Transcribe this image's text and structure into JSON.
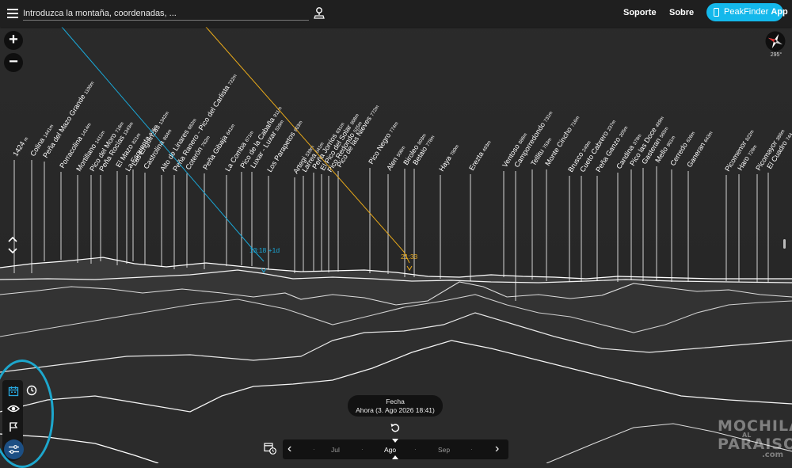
{
  "topbar": {
    "search_placeholder": "Introduzca la montaña, coordenadas, ...",
    "support_label": "Soporte",
    "about_label": "Sobre",
    "app_brand": "PeakFinder",
    "app_label": "App",
    "app_color": "#14b8eb"
  },
  "controls": {
    "zoom_in": "+",
    "zoom_out": "−",
    "heading": "295°",
    "scroll_up_icon": "chevron-up-icon",
    "scroll_down_icon": "chevron-down-icon"
  },
  "sidebar": {
    "icons": [
      "calendar-icon",
      "clock-icon",
      "eye-icon",
      "flag-icon",
      "sliders-icon"
    ],
    "active_color": "#1c4f84",
    "highlight_color": "#1da7cd"
  },
  "peaks": [
    {
      "name": "1424",
      "elevation": "m"
    },
    {
      "name": "Colina",
      "elevation": "1441m"
    },
    {
      "name": "Peña del Mazo Grande",
      "elevation": "1190m"
    },
    {
      "name": "Porracolina",
      "elevation": "1414m"
    },
    {
      "name": "Mortillano",
      "elevation": "1411m"
    },
    {
      "name": "Pico del Moro",
      "elevation": "716m"
    },
    {
      "name": "Peña Rocías",
      "elevation": "1343m"
    },
    {
      "name": "El Mazo",
      "elevation": "821m"
    },
    {
      "name": "La Esquenta",
      "elevation": "976m"
    },
    {
      "name": "Las Enguinzas",
      "elevation": "1342m"
    },
    {
      "name": "Castrolina",
      "elevation": "864m"
    },
    {
      "name": "Alto de Linares",
      "elevation": "682m"
    },
    {
      "name": "Peña Ranero - Pico del Carlista",
      "elevation": "722m"
    },
    {
      "name": "Coterón",
      "elevation": "762m"
    },
    {
      "name": "Peña Gibaja",
      "elevation": "641m"
    },
    {
      "name": "La Comba",
      "elevation": "671m"
    },
    {
      "name": "Pico de la Cabaña",
      "elevation": "911m"
    },
    {
      "name": "Luxar - Luxar",
      "elevation": "528m"
    },
    {
      "name": "Los Parapetos",
      "elevation": "803m"
    },
    {
      "name": "Artegi",
      "elevation": "539m"
    },
    {
      "name": "Larrea",
      "elevation": "541m"
    },
    {
      "name": "Peña Jorrios",
      "elevation": "631m"
    },
    {
      "name": "El Pico del Solar",
      "elevation": "808m"
    },
    {
      "name": "Pico Redondo",
      "elevation": "525m"
    },
    {
      "name": "Pico de las Nieves",
      "elevation": "772m"
    },
    {
      "name": "Pico Negro",
      "elevation": "774m"
    },
    {
      "name": "Alen",
      "elevation": "506m"
    },
    {
      "name": "Biroleo",
      "elevation": "803m"
    },
    {
      "name": "Betaio",
      "elevation": "778m"
    },
    {
      "name": "Haya",
      "elevation": "780m"
    },
    {
      "name": "Erezta",
      "elevation": "493m"
    },
    {
      "name": "Ventoso",
      "elevation": "886m"
    },
    {
      "name": "Camporredondo",
      "elevation": "731m"
    },
    {
      "name": "Tellitu",
      "elevation": "753m"
    },
    {
      "name": "Monte Cincho",
      "elevation": "716m"
    },
    {
      "name": "Brusco",
      "elevation": "249m"
    },
    {
      "name": "Cueto Cabrero",
      "elevation": "237m"
    },
    {
      "name": "Peña Ganzo",
      "elevation": "205m"
    },
    {
      "name": "Candina",
      "elevation": "378m"
    },
    {
      "name": "Pico las Doce",
      "elevation": "489m"
    },
    {
      "name": "Gasteran",
      "elevation": "565m"
    },
    {
      "name": "Mello",
      "elevation": "801m"
    },
    {
      "name": "Cerredo",
      "elevation": "626m"
    },
    {
      "name": "Ganeran",
      "elevation": "643m"
    },
    {
      "name": "Picomenor",
      "elevation": "822m"
    },
    {
      "name": "Haro",
      "elevation": "728m"
    },
    {
      "name": "Picomayor",
      "elevation": "386m"
    },
    {
      "name": "El Cuadro",
      "elevation": "744"
    }
  ],
  "sun": {
    "moon_label": "13:18 +1d",
    "sun_label": "21:33",
    "moon_color": "#1aa7d6",
    "sun_color": "#e8a91a"
  },
  "date": {
    "title": "Fecha",
    "value": "Ahora (3. Ago 2026 18:41)"
  },
  "timeline": {
    "months": [
      "Jul",
      "Ago",
      "Sep"
    ],
    "current": "Ago",
    "prev_icon": "chevron-left-icon",
    "next_icon": "chevron-right-icon",
    "reset_icon": "undo-icon"
  },
  "watermark": {
    "line1": "MOCHILA",
    "line2": "AL",
    "line3": "PARAISO",
    "line4": ".com"
  }
}
